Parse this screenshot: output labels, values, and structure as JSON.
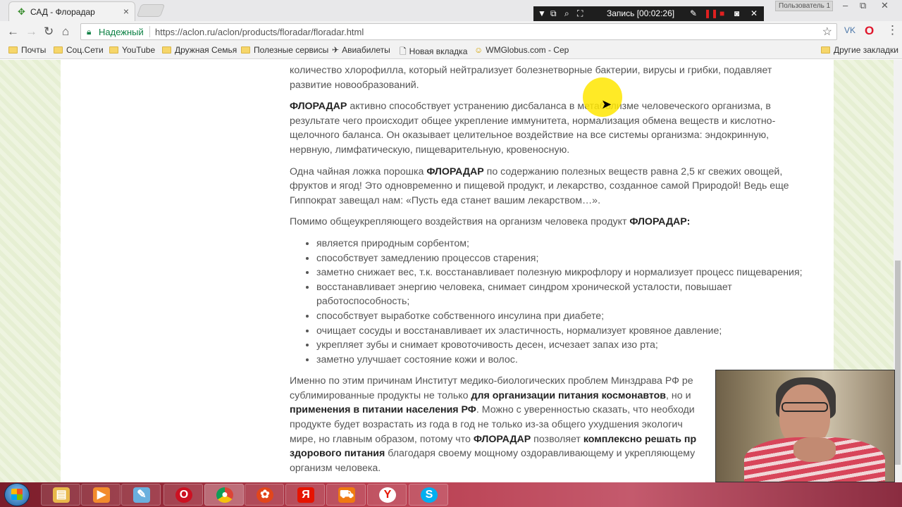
{
  "browser": {
    "tab_title": "САД - Флорадар",
    "secure_label": "Надежный",
    "url": "https://aclon.ru/aclon/products/floradar/floradar.html",
    "user_badge": "Пользователь 1"
  },
  "recorder": {
    "label": "Запись [00:02:26]"
  },
  "bookmarks": {
    "items": [
      "Почты",
      "Соц.Сети",
      "YouTube",
      "Дружная Семья",
      "Полезные сервисы",
      "Авиабилеты",
      "Новая вкладка",
      "WMGlobus.com - Сер"
    ],
    "other": "Другие закладки"
  },
  "article": {
    "p0": "количество хлорофилла, который нейтрализует болезнетворные бактерии, вирусы и грибки, подавляет развитие новообразований.",
    "p1_bold": "ФЛОРАДАР",
    "p1_rest": " активно способствует устранению дисбаланса в метаболизме человеческого организма, в результате чего происходит общее укрепление иммунитета, нормализация обмена веществ и кислотно-щелочного баланса. Он оказывает целительное воздействие на все системы организма: эндокринную, нервную, лимфатическую, пищеварительную, кровеносную.",
    "p2_a": "Одна чайная ложка порошка ",
    "p2_bold": "ФЛОРАДАР",
    "p2_b": " по содержанию полезных веществ равна 2,5 кг свежих овощей, фруктов и ягод! Это одновременно и пищевой продукт, и лекарство, созданное самой Природой! Ведь еще Гиппократ завещал нам: «Пусть еда станет вашим лекарством…».",
    "p3_a": "Помимо общеукрепляющего воздействия на организм человека продукт ",
    "p3_bold": "ФЛОРАДАР:",
    "list": [
      "является природным сорбентом;",
      "способствует замедлению процессов старения;",
      "заметно снижает вес, т.к. восстанавливает полезную микрофлору и нормализует процесс пищеварения;",
      "восстанавливает энергию человека, снимает синдром хронической усталости, повышает работоспособность;",
      "способствует выработке собственного инсулина при диабете;",
      "очищает сосуды и восстанавливает их эластичность, нормализует кровяное давление;",
      "укрепляет зубы и снимает кровоточивость десен, исчезает запах изо рта;",
      "заметно улучшает состояние кожи и волос."
    ],
    "p4_a": "Именно по этим причинам Институт медико-биологических проблем Минздрава РФ ре",
    "p4_b": "сублимированные продукты не только ",
    "p4_bold1": "для организации питания космонавтов",
    "p4_c": ", но и",
    "p4_bold2": "применения в питании населения РФ",
    "p4_d": ". Можно с уверенностью сказать, что необходи",
    "p4_e": "продукте будет возрастать из года в год не только из-за общего ухудшения экологич",
    "p4_f": "мире, но главным образом, потому что ",
    "p4_bold3": "ФЛОРАДАР",
    "p4_g": " позволяет ",
    "p4_bold4": "комплексно решать пр",
    "p4_bold5": "здорового питания",
    "p4_h": " благодаря своему мощному оздоравливающему и укрепляющему",
    "p4_i": "организм человека."
  },
  "taskbar": {
    "icons": [
      "explorer",
      "media-player",
      "paint",
      "opera",
      "chrome",
      "app",
      "yandex",
      "shop",
      "yandex-browser",
      "skype"
    ]
  }
}
